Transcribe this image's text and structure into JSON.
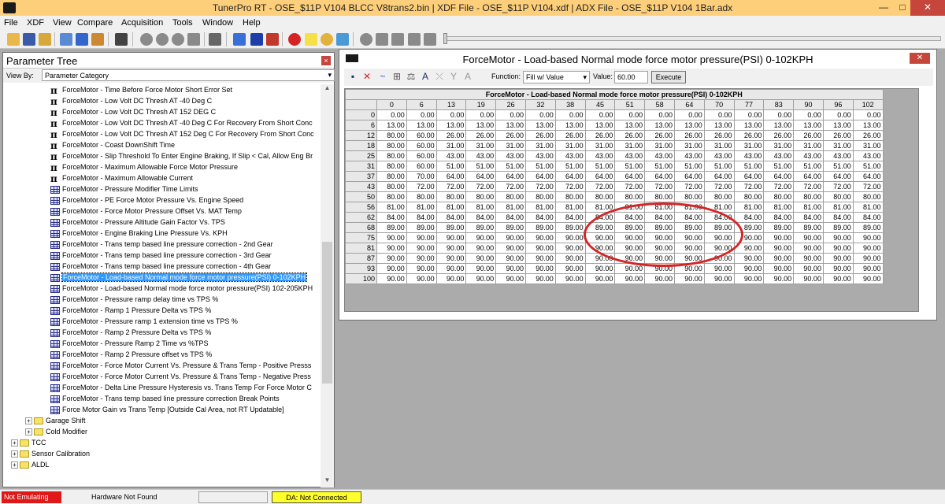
{
  "window": {
    "title": "TunerPro RT - OSE_$11P V104 BLCC V8trans2.bin | XDF File - OSE_$11P V104.xdf | ADX File - OSE_$11P V104 1Bar.adx",
    "min": "—",
    "max": "□",
    "close": "✕"
  },
  "menu": [
    "File",
    "XDF",
    "View",
    "Compare",
    "Acquisition",
    "Tools",
    "Window",
    "Help"
  ],
  "tree": {
    "title": "Parameter Tree",
    "close": "×",
    "view_by_label": "View By:",
    "view_by_value": "Parameter Category",
    "items": [
      {
        "icon": "pi",
        "label": "ForceMotor - Time Before Force Motor Short Error Set"
      },
      {
        "icon": "pi",
        "label": "ForceMotor - Low Volt DC Thresh AT -40 Deg C"
      },
      {
        "icon": "pi",
        "label": "ForceMotor - Low Volt DC Thresh AT 152 DEG C"
      },
      {
        "icon": "pi",
        "label": "ForceMotor - Low Volt DC Thresh AT -40 Deg C For Recovery From Short Conc"
      },
      {
        "icon": "pi",
        "label": "ForceMotor - Low Volt DC Thresh AT 152 Deg C For Recovery From Short Conc"
      },
      {
        "icon": "pi",
        "label": "ForceMotor - Coast DownShift Time"
      },
      {
        "icon": "pi",
        "label": "ForceMotor - Slip Threshold To Enter Engine Braking, If Slip < Cal, Allow Eng Br"
      },
      {
        "icon": "pi",
        "label": "ForceMotor - Maximum Allowable Force Motor Pressure"
      },
      {
        "icon": "pi",
        "label": "ForceMotor - Maximum Allowable Current"
      },
      {
        "icon": "grid",
        "label": "ForceMotor - Pressure Modifier Time Limits"
      },
      {
        "icon": "grid",
        "label": "ForceMotor - PE Force Motor Pressure Vs. Engine Speed"
      },
      {
        "icon": "grid",
        "label": "ForceMotor - Force Motor Pressure Offset Vs. MAT Temp"
      },
      {
        "icon": "grid",
        "label": "ForceMotor - Pressure Altitude Gain Factor Vs. TPS"
      },
      {
        "icon": "grid",
        "label": "ForceMotor - Engine Braking Line Pressure Vs. KPH"
      },
      {
        "icon": "grid",
        "label": "ForceMotor - Trans temp based line pressure correction - 2nd Gear"
      },
      {
        "icon": "grid",
        "label": "ForceMotor - Trans temp based line pressure correction - 3rd Gear"
      },
      {
        "icon": "grid",
        "label": "ForceMotor - Trans temp based line pressure correction - 4th Gear"
      },
      {
        "icon": "grid",
        "label": "ForceMotor - Load-based Normal mode force motor pressure(PSI) 0-102KPH",
        "selected": true
      },
      {
        "icon": "grid",
        "label": "ForceMotor - Load-based Normal mode force motor pressure(PSI) 102-205KPH"
      },
      {
        "icon": "grid",
        "label": "ForceMotor - Pressure ramp delay time vs TPS %"
      },
      {
        "icon": "grid",
        "label": "ForceMotor - Ramp 1 Pressure Delta vs TPS %"
      },
      {
        "icon": "grid",
        "label": "ForceMotor - Pressure ramp 1 extension time vs TPS %"
      },
      {
        "icon": "grid",
        "label": "ForceMotor - Ramp 2 Pressure Delta vs TPS %"
      },
      {
        "icon": "grid",
        "label": "ForceMotor - Pressure Ramp 2 Time vs %TPS"
      },
      {
        "icon": "grid",
        "label": "ForceMotor - Ramp 2 Pressure offset vs TPS %"
      },
      {
        "icon": "grid",
        "label": "ForceMotor - Force Motor Current Vs. Pressure & Trans Temp - Positive Presss"
      },
      {
        "icon": "grid",
        "label": "ForceMotor - Force Motor Current Vs. Pressure & Trans Temp - Negative Press"
      },
      {
        "icon": "grid",
        "label": "ForceMotor - Delta Line Pressure Hysteresis vs. Trans Temp For Force Motor C"
      },
      {
        "icon": "grid",
        "label": "ForceMotor - Trans temp based line pressure correction Break Points"
      },
      {
        "icon": "grid",
        "label": "Force Motor Gain vs Trans Temp [Outside Cal Area, not RT Updatable]"
      }
    ],
    "folders": [
      {
        "label": "Garage Shift",
        "level": 2
      },
      {
        "label": "Cold Modifier",
        "level": 2
      },
      {
        "label": "TCC",
        "level": 1
      },
      {
        "label": "Sensor Calibration",
        "level": 1
      },
      {
        "label": "ALDL",
        "level": 1
      }
    ]
  },
  "table_window": {
    "title": "ForceMotor - Load-based Normal mode force motor pressure(PSI) 0-102KPH",
    "close": "✕",
    "function_label": "Function:",
    "function_value": "Fill w/ Value",
    "value_label": "Value:",
    "value": "60.00",
    "execute_label": "Execute",
    "grid_title": "ForceMotor - Load-based Normal mode force motor pressure(PSI) 0-102KPH",
    "col_headers": [
      "0",
      "6",
      "13",
      "19",
      "26",
      "32",
      "38",
      "45",
      "51",
      "58",
      "64",
      "70",
      "77",
      "83",
      "90",
      "96",
      "102"
    ],
    "row_headers": [
      "0",
      "6",
      "12",
      "18",
      "25",
      "31",
      "37",
      "43",
      "50",
      "56",
      "62",
      "68",
      "75",
      "81",
      "87",
      "93",
      "100"
    ],
    "row_values": [
      "0.00",
      "13.00",
      "26.00",
      "31.00",
      "43.00",
      "51.00",
      "64.00",
      "72.00",
      "80.00",
      "81.00",
      "84.00",
      "89.00",
      "90.00",
      "90.00",
      "90.00",
      "90.00",
      "90.00"
    ],
    "row_first_values": [
      "0.00",
      "13.00",
      "80.00",
      "80.00",
      "80.00",
      "80.00",
      "80.00",
      "80.00",
      "80.00",
      "81.00",
      "84.00",
      "89.00",
      "90.00",
      "90.00",
      "90.00",
      "90.00",
      "90.00"
    ],
    "row_second_values": [
      "0.00",
      "13.00",
      "60.00",
      "60.00",
      "60.00",
      "60.00",
      "70.00",
      "72.00",
      "80.00",
      "81.00",
      "84.00",
      "89.00",
      "90.00",
      "90.00",
      "90.00",
      "90.00",
      "90.00"
    ]
  },
  "status": {
    "emulating": "Not Emulating",
    "hardware": "Hardware Not Found",
    "da": "DA: Not Connected"
  },
  "colors": {
    "titlebar": "#fdcf7a",
    "selection": "#3399ff",
    "highlight_circle": "#d62424",
    "not_emulating": "#e01818",
    "da_status": "#ffff2a"
  }
}
